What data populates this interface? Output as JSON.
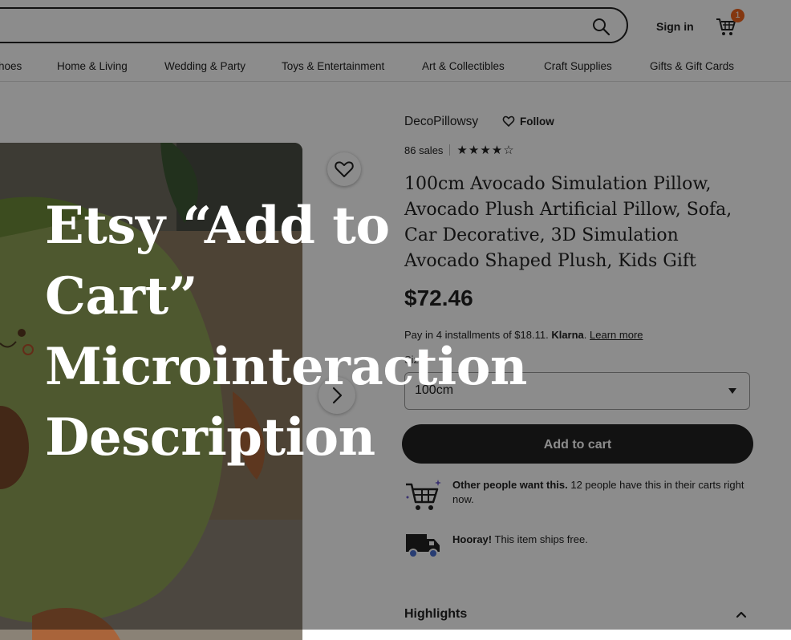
{
  "header": {
    "search_placeholder": "",
    "sign_in": "Sign in",
    "cart_count": "1",
    "icons": {
      "search": "search-icon",
      "cart": "cart-icon"
    }
  },
  "categories": [
    "Shoes",
    "Home & Living",
    "Wedding & Party",
    "Toys & Entertainment",
    "Art & Collectibles",
    "Craft Supplies",
    "Gifts & Gift Cards"
  ],
  "shop": {
    "name": "DecoPillowsy",
    "follow": "Follow",
    "sales": "86 sales",
    "rating": 4,
    "rating_max": 5
  },
  "product": {
    "title": "100cm Avocado Simulation Pillow, Avocado Plush Artificial Pillow, Sofa, Car Decorative, 3D Simulation Avocado Shaped Plush, Kids Gift",
    "price": "$72.46",
    "installments_text": "Pay in 4 installments of $18.11.",
    "klarna": "Klarna",
    "learn_more": "Learn more",
    "size_label": "Size",
    "size_required": "*",
    "size_value": "100cm",
    "add_to_cart": "Add to cart"
  },
  "perks": [
    {
      "bold": "Other people want this.",
      "text": " 12 people have this in their carts right now.",
      "icon": "cart-sparkle-icon"
    },
    {
      "bold": "Hooray!",
      "text": " This item ships free.",
      "icon": "truck-icon"
    }
  ],
  "highlights": "Highlights",
  "overlay": {
    "title": "Etsy “Add to Cart” Microinteraction Description"
  },
  "colors": {
    "accent": "#f1641e",
    "button": "#222222",
    "overlay": "rgba(0,0,0,0.45)"
  }
}
